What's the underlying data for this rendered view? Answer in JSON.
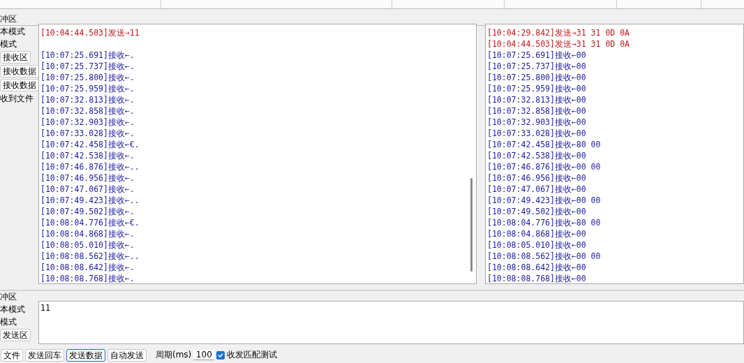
{
  "receive_area": {
    "legend": "冲区",
    "options": [
      "本模式",
      "模式"
    ],
    "buttons": [
      "接收区",
      "接收数据",
      "接收数据"
    ],
    "note": "收到文件",
    "log_text": [
      {
        "kind": "send",
        "text": "[10:04:44.503]发送→11"
      },
      {
        "kind": "blank"
      },
      {
        "kind": "recv",
        "text": "[10:07:25.691]接收←."
      },
      {
        "kind": "recv",
        "text": "[10:07:25.737]接收←."
      },
      {
        "kind": "recv",
        "text": "[10:07:25.800]接收←."
      },
      {
        "kind": "recv",
        "text": "[10:07:25.959]接收←."
      },
      {
        "kind": "recv",
        "text": "[10:07:32.813]接收←."
      },
      {
        "kind": "recv",
        "text": "[10:07:32.858]接收←."
      },
      {
        "kind": "recv",
        "text": "[10:07:32.903]接收←."
      },
      {
        "kind": "recv",
        "text": "[10:07:33.028]接收←."
      },
      {
        "kind": "recv",
        "text": "[10:07:42.458]接收←€."
      },
      {
        "kind": "recv",
        "text": "[10:07:42.538]接收←."
      },
      {
        "kind": "recv",
        "text": "[10:07:46.876]接收←.."
      },
      {
        "kind": "recv",
        "text": "[10:07:46.956]接收←."
      },
      {
        "kind": "recv",
        "text": "[10:07:47.067]接收←."
      },
      {
        "kind": "recv",
        "text": "[10:07:49.423]接收←.."
      },
      {
        "kind": "recv",
        "text": "[10:07:49.502]接收←."
      },
      {
        "kind": "recv",
        "text": "[10:08:04.776]接收←€."
      },
      {
        "kind": "recv",
        "text": "[10:08:04.868]接收←."
      },
      {
        "kind": "recv",
        "text": "[10:08:05.010]接收←."
      },
      {
        "kind": "recv",
        "text": "[10:08:08.562]接收←.."
      },
      {
        "kind": "recv",
        "text": "[10:08:08.642]接收←."
      },
      {
        "kind": "recv",
        "text": "[10:08:08.768]接收←."
      }
    ],
    "log_hex": [
      {
        "kind": "send",
        "text": "[10:04:29.842]发送→31 31 0D 0A"
      },
      {
        "kind": "send",
        "text": "[10:04:44.503]发送→31 31 0D 0A"
      },
      {
        "kind": "recv",
        "text": "[10:07:25.691]接收←00"
      },
      {
        "kind": "recv",
        "text": "[10:07:25.737]接收←00"
      },
      {
        "kind": "recv",
        "text": "[10:07:25.800]接收←00"
      },
      {
        "kind": "recv",
        "text": "[10:07:25.959]接收←00"
      },
      {
        "kind": "recv",
        "text": "[10:07:32.813]接收←00"
      },
      {
        "kind": "recv",
        "text": "[10:07:32.858]接收←00"
      },
      {
        "kind": "recv",
        "text": "[10:07:32.903]接收←00"
      },
      {
        "kind": "recv",
        "text": "[10:07:33.028]接收←00"
      },
      {
        "kind": "recv",
        "text": "[10:07:42.458]接收←80 00"
      },
      {
        "kind": "recv",
        "text": "[10:07:42.538]接收←00"
      },
      {
        "kind": "recv",
        "text": "[10:07:46.876]接收←00 00"
      },
      {
        "kind": "recv",
        "text": "[10:07:46.956]接收←00"
      },
      {
        "kind": "recv",
        "text": "[10:07:47.067]接收←00"
      },
      {
        "kind": "recv",
        "text": "[10:07:49.423]接收←00 00"
      },
      {
        "kind": "recv",
        "text": "[10:07:49.502]接收←00"
      },
      {
        "kind": "recv",
        "text": "[10:08:04.776]接收←80 00"
      },
      {
        "kind": "recv",
        "text": "[10:08:04.868]接收←00"
      },
      {
        "kind": "recv",
        "text": "[10:08:05.010]接收←00"
      },
      {
        "kind": "recv",
        "text": "[10:08:08.562]接收←00 00"
      },
      {
        "kind": "recv",
        "text": "[10:08:08.642]接收←00"
      },
      {
        "kind": "recv",
        "text": "[10:08:08.768]接收←00"
      }
    ]
  },
  "send_area": {
    "legend": "冲区",
    "options": [
      "本模式",
      "模式"
    ],
    "button": "发送区",
    "value": "11"
  },
  "bottom_bar": {
    "buttons": [
      {
        "label": "文件",
        "focused": false
      },
      {
        "label": "发送回车",
        "focused": false
      },
      {
        "label": "发送数据",
        "focused": true
      },
      {
        "label": "自动发送",
        "focused": false
      }
    ],
    "period_label": "周期(ms)",
    "period_value": "100",
    "match_test": {
      "label": "收发匹配测试",
      "checked": true
    }
  }
}
